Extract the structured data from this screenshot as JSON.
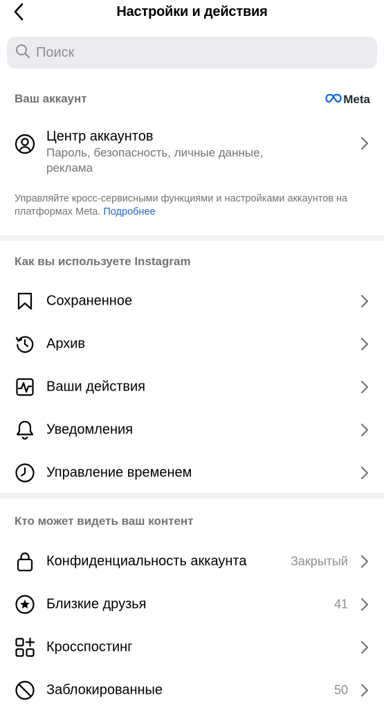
{
  "header": {
    "title": "Настройки и действия",
    "back_icon": "chevron-left-icon"
  },
  "search": {
    "placeholder": "Поиск",
    "icon": "search-icon"
  },
  "account_section": {
    "heading": "Ваш аккаунт",
    "brand": "Meta",
    "accounts_center": {
      "title": "Центр аккаунтов",
      "subtitle": "Пароль, безопасность, личные данные, реклама",
      "icon": "user-circle-icon"
    },
    "description": "Управляйте кросс-сервисными функциями и настройками аккаунтов на платформах Meta.",
    "link": "Подробнее"
  },
  "usage_section": {
    "heading": "Как вы используете Instagram",
    "items": [
      {
        "label": "Сохраненное",
        "icon": "bookmark-icon"
      },
      {
        "label": "Архив",
        "icon": "archive-history-icon"
      },
      {
        "label": "Ваши действия",
        "icon": "activity-icon"
      },
      {
        "label": "Уведомления",
        "icon": "bell-icon"
      },
      {
        "label": "Управление временем",
        "icon": "clock-icon"
      }
    ]
  },
  "visibility_section": {
    "heading": "Кто может видеть ваш контент",
    "items": [
      {
        "label": "Конфиденциальность аккаунта",
        "value": "Закрытый",
        "icon": "lock-icon"
      },
      {
        "label": "Близкие друзья",
        "value": "41",
        "icon": "star-circle-icon"
      },
      {
        "label": "Кросспостинг",
        "value": "",
        "icon": "crosspost-grid-icon"
      },
      {
        "label": "Заблокированные",
        "value": "50",
        "icon": "blocked-icon"
      }
    ]
  },
  "colors": {
    "background": "#f2f2f5",
    "card": "#ffffff",
    "muted": "#737373",
    "link": "#2264d1"
  }
}
